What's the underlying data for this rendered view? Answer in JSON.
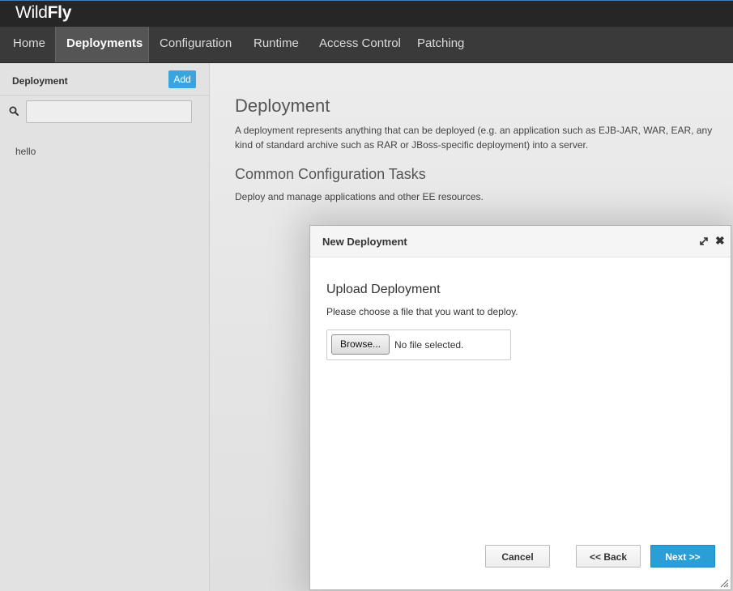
{
  "brand": {
    "part1": "Wild",
    "part2": "Fly"
  },
  "nav": [
    {
      "label": "Home"
    },
    {
      "label": "Deployments",
      "active": true
    },
    {
      "label": "Configuration"
    },
    {
      "label": "Runtime"
    },
    {
      "label": "Access Control"
    },
    {
      "label": "Patching"
    }
  ],
  "sidebar": {
    "title": "Deployment",
    "add_label": "Add",
    "search_placeholder": "",
    "items": [
      "hello"
    ]
  },
  "main": {
    "title": "Deployment",
    "description": "A deployment represents anything that can be deployed (e.g. an application such as EJB-JAR, WAR, EAR, any kind of standard archive such as RAR or JBoss-specific deployment) into a server.",
    "tasks_title": "Common Configuration Tasks",
    "tasks_description": "Deploy and manage applications and other EE resources."
  },
  "modal": {
    "title": "New Deployment",
    "upload_title": "Upload Deployment",
    "upload_description": "Please choose a file that you want to deploy.",
    "browse_label": "Browse...",
    "file_status": "No file selected.",
    "cancel_label": "Cancel",
    "back_label": "<< Back",
    "next_label": "Next >>"
  },
  "colors": {
    "accent": "#39a5dc",
    "primary_button": "#2a9ed7",
    "header": "#262626",
    "navbar": "#3a3a3a"
  },
  "icons": {
    "search": "search-icon",
    "maximize": "maximize-icon",
    "close": "close-icon",
    "resize": "resize-handle-icon"
  }
}
